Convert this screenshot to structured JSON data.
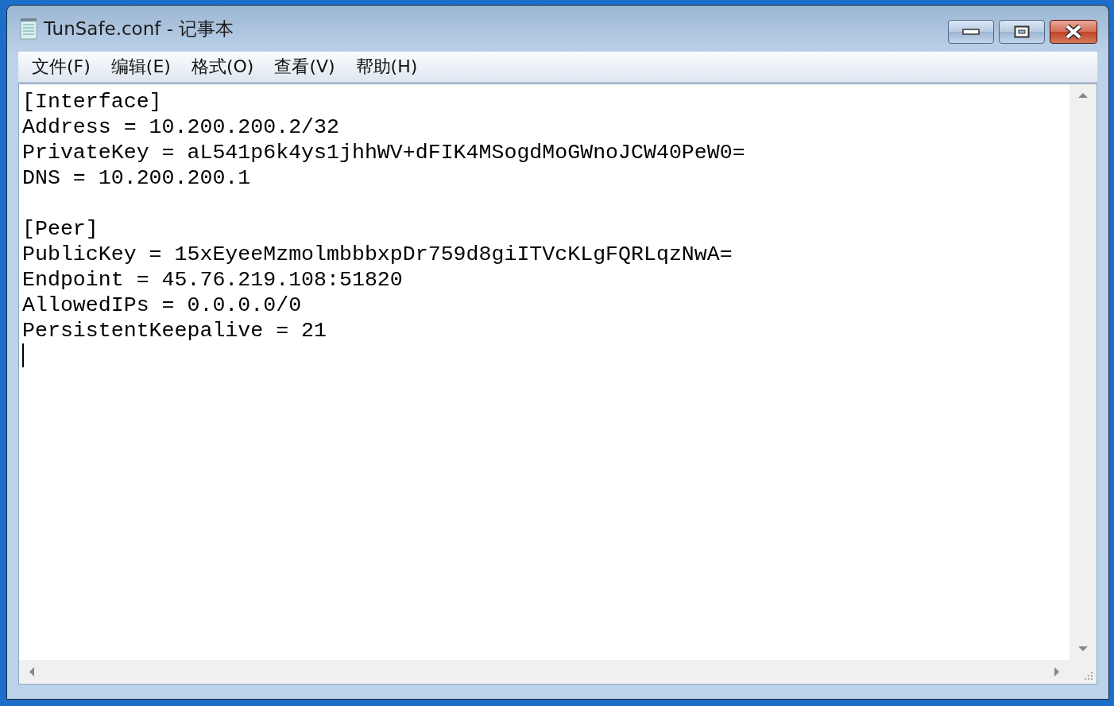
{
  "window": {
    "title": "TunSafe.conf - 记事本"
  },
  "menu": [
    "文件(F)",
    "编辑(E)",
    "格式(O)",
    "查看(V)",
    "帮助(H)"
  ],
  "editor": {
    "sections": [
      {
        "lines": [
          "[Interface]",
          "Address = 10.200.200.2/32",
          "PrivateKey = aL541p6k4ys1jhhWV+dFIK4MSogdMoGWnoJCW40PeW0=",
          "DNS = 10.200.200.1"
        ]
      },
      {
        "lines": [
          "[Peer]",
          "PublicKey = 15xEyeeMzmolmbbbxpDr759d8giITVcKLgFQRLqzNwA=",
          "Endpoint = 45.76.219.108:51820",
          "AllowedIPs = 0.0.0.0/0",
          "PersistentKeepalive = 21"
        ]
      }
    ]
  }
}
